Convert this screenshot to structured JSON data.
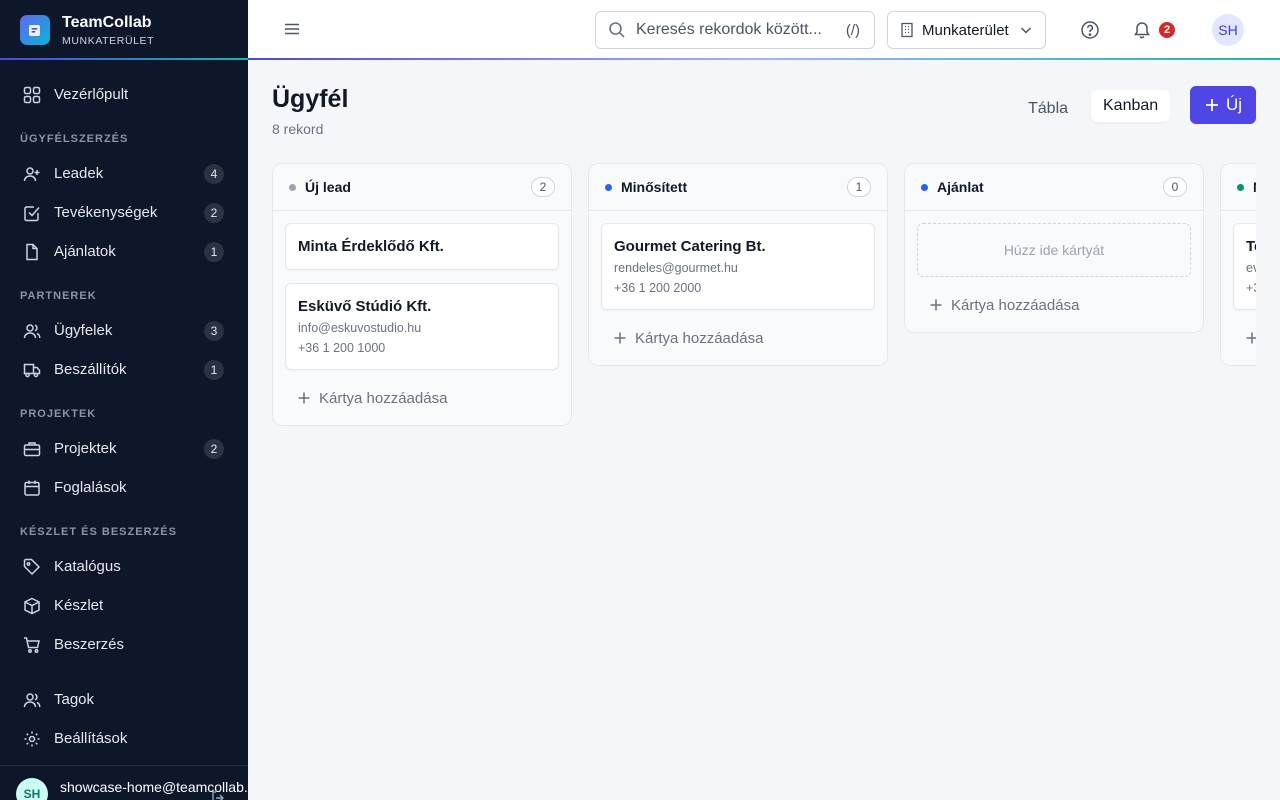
{
  "brand": {
    "title": "TeamCollab",
    "subtitle": "MUNKATERÜLET"
  },
  "sidebar": {
    "dashboard": {
      "label": "Vezérlőpult"
    },
    "sections": [
      {
        "title": "ÜGYFÉLSZERZÉS",
        "items": [
          {
            "label": "Leadek",
            "badge": "4"
          },
          {
            "label": "Tevékenységek",
            "badge": "2"
          },
          {
            "label": "Ajánlatok",
            "badge": "1"
          }
        ]
      },
      {
        "title": "PARTNEREK",
        "items": [
          {
            "label": "Ügyfelek",
            "badge": "3"
          },
          {
            "label": "Beszállítók",
            "badge": "1"
          }
        ]
      },
      {
        "title": "PROJEKTEK",
        "items": [
          {
            "label": "Projektek",
            "badge": "2"
          },
          {
            "label": "Foglalások"
          }
        ]
      },
      {
        "title": "KÉSZLET ÉS BESZERZÉS",
        "items": [
          {
            "label": "Katalógus"
          },
          {
            "label": "Készlet"
          },
          {
            "label": "Beszerzés"
          }
        ]
      }
    ],
    "bottom": [
      {
        "label": "Tagok"
      },
      {
        "label": "Beállítások"
      }
    ],
    "user": {
      "initials": "SH",
      "email": "showcase-home@teamcollab."
    }
  },
  "topbar": {
    "search_placeholder": "Keresés rekordok között...",
    "search_shortcut": "(/)",
    "workspace": "Munkaterület",
    "notification_count": "2",
    "avatar_initials": "SH"
  },
  "page": {
    "title": "Ügyfél",
    "subtitle": "8 rekord",
    "view_table": "Tábla",
    "view_kanban": "Kanban",
    "new_label": "Új"
  },
  "board": {
    "add_card_label": "Kártya hozzáadása",
    "drop_hint": "Húzz ide kártyát",
    "columns": [
      {
        "name": "Új lead",
        "count": "2",
        "color": "#9ca3af",
        "cards": [
          {
            "title": "Minta Érdeklődő Kft."
          },
          {
            "title": "Esküvő Stúdió Kft.",
            "email": "info@eskuvostudio.hu",
            "phone": "+36 1 200 1000"
          }
        ]
      },
      {
        "name": "Minősített",
        "count": "1",
        "color": "#2563eb",
        "cards": [
          {
            "title": "Gourmet Catering Bt.",
            "email": "rendeles@gourmet.hu",
            "phone": "+36 1 200 2000"
          }
        ]
      },
      {
        "name": "Ajánlat",
        "count": "0",
        "color": "#2563eb",
        "cards": []
      },
      {
        "name": "N",
        "count": "",
        "color": "#059669",
        "cards": [
          {
            "title": "Te",
            "email": "ev",
            "phone": "+3"
          }
        ]
      }
    ]
  }
}
